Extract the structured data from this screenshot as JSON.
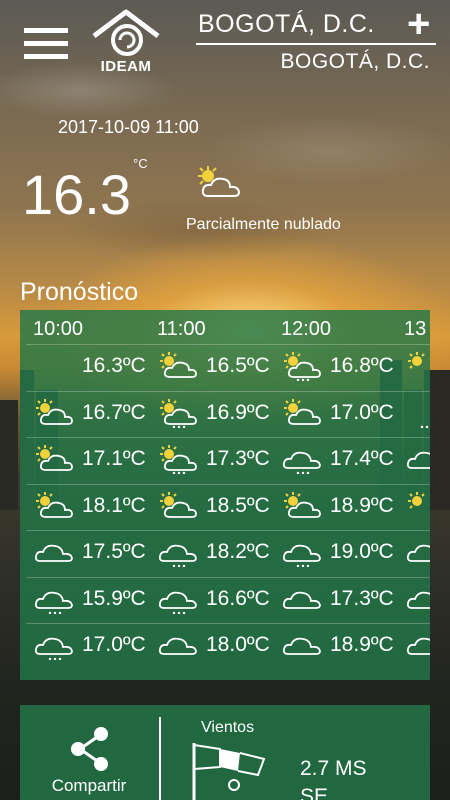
{
  "header": {
    "city_main": "BOGOTÁ, D.C.",
    "city_sub": "BOGOTÁ, D.C.",
    "logo_text": "IDEAM",
    "add_label": "+"
  },
  "current": {
    "datetime": "2017-10-09 11:00",
    "temperature": "16.3",
    "unit": "°C",
    "condition": "Parcialmente nublado",
    "condition_icon": "partly-cloudy-icon"
  },
  "forecast": {
    "title": "Pronóstico",
    "hours": [
      "10:00",
      "11:00",
      "12:00",
      "13"
    ],
    "rows": [
      [
        {
          "icon": "none",
          "temp": "16.3ºC"
        },
        {
          "icon": "partly-cloudy",
          "temp": "16.5ºC"
        },
        {
          "icon": "partly-cloudy-rain",
          "temp": "16.8ºC"
        },
        {
          "icon": "sun",
          "temp": ""
        }
      ],
      [
        {
          "icon": "partly-cloudy",
          "temp": "16.7ºC"
        },
        {
          "icon": "partly-cloudy-rain",
          "temp": "16.9ºC"
        },
        {
          "icon": "partly-cloudy",
          "temp": "17.0ºC"
        },
        {
          "icon": "rain",
          "temp": ""
        }
      ],
      [
        {
          "icon": "partly-cloudy",
          "temp": "17.1ºC"
        },
        {
          "icon": "partly-cloudy-rain",
          "temp": "17.3ºC"
        },
        {
          "icon": "cloud-rain",
          "temp": "17.4ºC"
        },
        {
          "icon": "cloud",
          "temp": ""
        }
      ],
      [
        {
          "icon": "partly-cloudy",
          "temp": "18.1ºC"
        },
        {
          "icon": "partly-cloudy",
          "temp": "18.5ºC"
        },
        {
          "icon": "partly-cloudy",
          "temp": "18.9ºC"
        },
        {
          "icon": "sun",
          "temp": ""
        }
      ],
      [
        {
          "icon": "cloud",
          "temp": "17.5ºC"
        },
        {
          "icon": "cloud-rain",
          "temp": "18.2ºC"
        },
        {
          "icon": "cloud-rain",
          "temp": "19.0ºC"
        },
        {
          "icon": "cloud",
          "temp": ""
        }
      ],
      [
        {
          "icon": "cloud-rain",
          "temp": "15.9ºC"
        },
        {
          "icon": "cloud-rain",
          "temp": "16.6ºC"
        },
        {
          "icon": "cloud",
          "temp": "17.3ºC"
        },
        {
          "icon": "cloud",
          "temp": ""
        }
      ],
      [
        {
          "icon": "cloud-rain",
          "temp": "17.0ºC"
        },
        {
          "icon": "cloud",
          "temp": "18.0ºC"
        },
        {
          "icon": "cloud",
          "temp": "18.9ºC"
        },
        {
          "icon": "cloud",
          "temp": ""
        }
      ]
    ]
  },
  "bottom": {
    "share_label": "Compartir",
    "winds_label": "Vientos",
    "wind_speed": "2.7 MS",
    "wind_direction": "SE"
  },
  "colors": {
    "panel": "#22784a",
    "sun": "#f2d13a"
  }
}
